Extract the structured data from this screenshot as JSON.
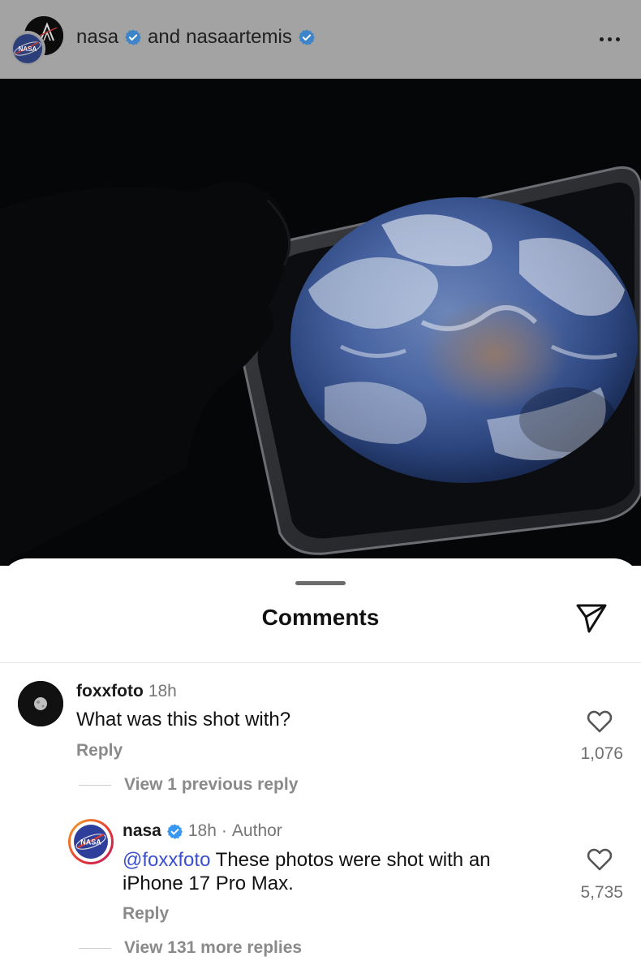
{
  "header": {
    "username": "nasa",
    "joiner": "and",
    "collaborator": "nasaartemis",
    "logo_text": "NASA"
  },
  "sheet": {
    "title": "Comments"
  },
  "comments": [
    {
      "username": "foxxfoto",
      "time": "18h",
      "text": "What was this shot with?",
      "reply_label": "Reply",
      "likes": "1,076",
      "view_replies": "View 1 previous reply"
    },
    {
      "username": "nasa",
      "time": "18h",
      "separator": "·",
      "author_label": "Author",
      "mention": "@foxxfoto",
      "text": "These photos were shot with an iPhone 17 Pro Max.",
      "reply_label": "Reply",
      "likes": "5,735",
      "view_replies": "View 131 more replies",
      "logo_text": "NASA"
    }
  ],
  "colors": {
    "verified": "#3897f0",
    "mention": "#3a4fc9",
    "story_ring_start": "#f9a825",
    "story_ring_end": "#c2185b"
  },
  "icons": [
    "verified-badge-icon",
    "more-options-icon",
    "share-send-icon",
    "heart-icon"
  ]
}
